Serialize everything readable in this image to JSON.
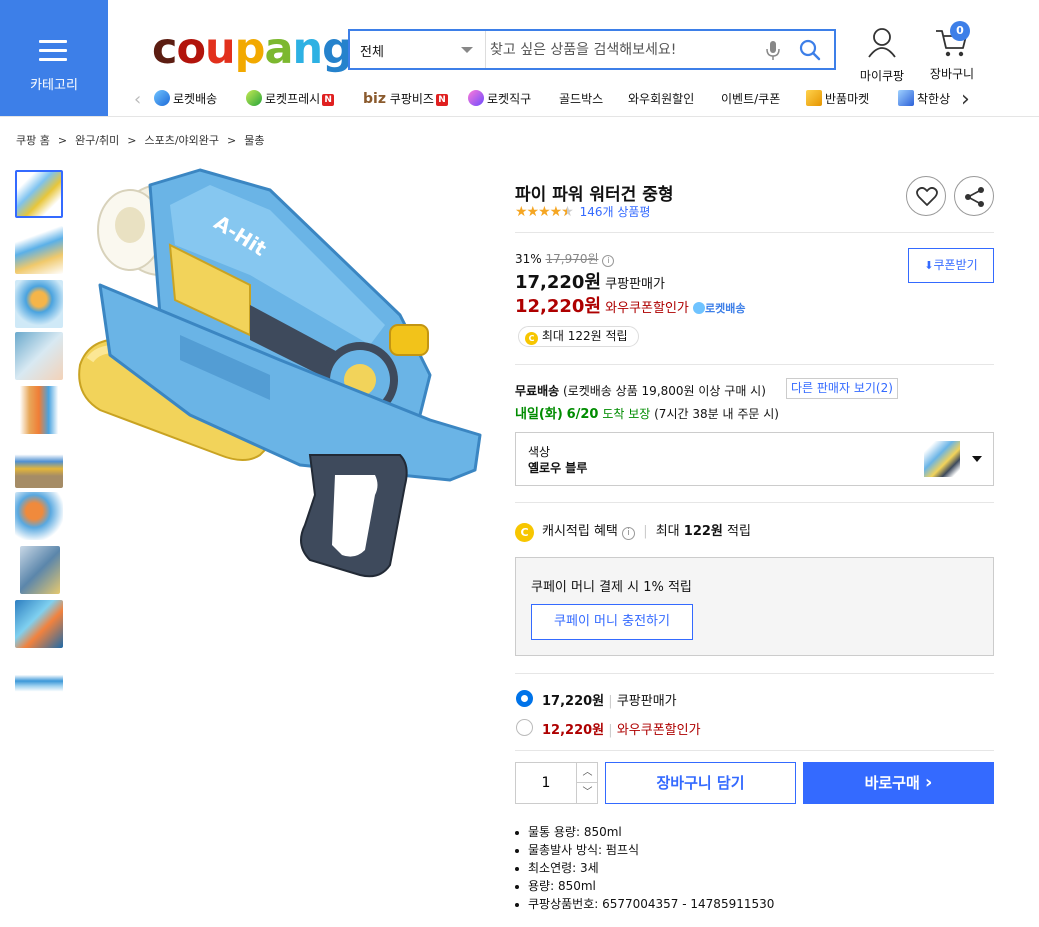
{
  "header": {
    "category_label": "카테고리",
    "logo": {
      "c": "c",
      "o": "o",
      "u": "u",
      "p": "p",
      "a": "a",
      "n": "n",
      "g": "g"
    },
    "search": {
      "category": "전체",
      "placeholder": "찾고 싶은 상품을 검색해보세요!"
    },
    "mycoupang_label": "마이쿠팡",
    "cart_label": "장바구니",
    "cart_count": "0"
  },
  "nav": {
    "items": [
      {
        "label": "로켓배송"
      },
      {
        "label": "로켓프레시",
        "badge": "N"
      },
      {
        "prefix": "biz",
        "label": "쿠팡비즈",
        "badge": "N"
      },
      {
        "label": "로켓직구"
      },
      {
        "label": "골드박스"
      },
      {
        "label": "와우회원할인"
      },
      {
        "label": "이벤트/쿠폰"
      },
      {
        "label": "반품마켓"
      },
      {
        "label": "착한상"
      }
    ]
  },
  "breadcrumb": [
    "쿠팡 홈",
    ">",
    "완구/취미",
    ">",
    "스포츠/야외완구",
    ">",
    "물총"
  ],
  "product": {
    "title": "파이 파워 워터건 중형",
    "rating": 4.5,
    "review_count": "146개 상품평",
    "discount_rate": "31%",
    "original_price": "17,970원",
    "price": "17,220원",
    "price_label": "쿠팡판매가",
    "wow_price": "12,220원",
    "wow_label": "와우쿠폰할인가",
    "rocket_label": "로켓배송",
    "coupon_button": "쿠폰받기",
    "points_badge": "최대 122원 적립",
    "shipping_bold": "무료배송",
    "shipping_detail": "(로켓배송 상품 19,800원 이상 구매 시)",
    "other_sellers": "다른 판매자 보기(2)",
    "arrival_day": "내일(화)",
    "arrival_date": "6/20",
    "arrival_text": "도착 보장",
    "arrival_note": "(7시간 38분 내 주문 시)",
    "option_label": "색상",
    "option_value": "옐로우 블루",
    "cash_title": "캐시적립 혜택",
    "cash_max": "최대",
    "cash_amount": "122원",
    "cash_suffix": "적립",
    "coupay_text": "쿠페이 머니 결제 시 1% 적립",
    "coupay_button": "쿠페이 머니 충전하기",
    "radio_price1": "17,220원",
    "radio_label1": "쿠팡판매가",
    "radio_price2": "12,220원",
    "radio_label2": "와우쿠폰할인가",
    "quantity": "1",
    "cart_button": "장바구니 담기",
    "buy_button": "바로구매",
    "specs": [
      "물통 용량: 850ml",
      "물총발사 방식: 펌프식",
      "최소연령: 3세",
      "용량: 850ml",
      "쿠팡상품번호: 6577004357 - 14785911530"
    ]
  },
  "gun_text": "A-Hit",
  "colors": {
    "accent": "#3d7fe8",
    "wow_red": "#ae0000",
    "green": "#008c00",
    "buy_blue": "#346aff"
  }
}
